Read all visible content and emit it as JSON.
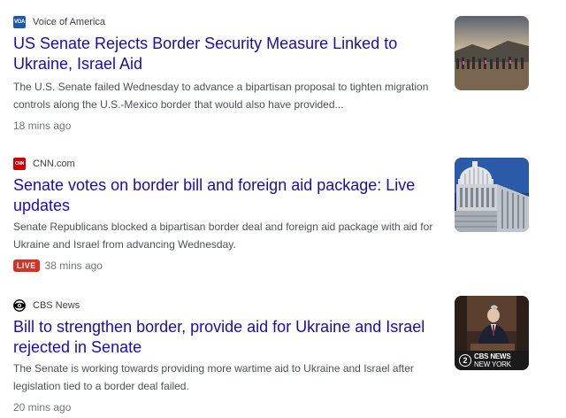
{
  "articles": [
    {
      "source": "Voice of America",
      "favicon_text": "VOA",
      "headline": "US Senate Rejects Border Security Measure Linked to Ukraine, Israel Aid",
      "snippet": "The U.S. Senate failed Wednesday to advance a bipartisan proposal to tighten migration controls along the U.S.-Mexico border that would also have provided...",
      "time": "18 mins ago",
      "live": false
    },
    {
      "source": "CNN.com",
      "favicon_text": "CNN",
      "headline": "Senate votes on border bill and foreign aid package: Live updates",
      "snippet": "Senate Republicans blocked a bipartisan border deal and foreign aid package with aid for Ukraine and Israel from advancing Wednesday.",
      "time": "38 mins ago",
      "live": true,
      "live_label": "LIVE"
    },
    {
      "source": "CBS News",
      "headline": "Bill to strengthen border, provide aid for Ukraine and Israel rejected in Senate",
      "snippet": "The Senate is working towards providing more wartime aid to Ukraine and Israel after legislation tied to a border deal failed.",
      "time": "20 mins ago",
      "live": false,
      "thumb_overlay": {
        "channel": "2",
        "brand": "CBS NEWS",
        "city": "NEW YORK"
      }
    }
  ],
  "colors": {
    "headline": "#1a0dab",
    "snippet": "#4d5156",
    "time": "#70757a",
    "live": "#d93025"
  },
  "icons": [
    "voa-favicon",
    "cnn-favicon",
    "cbs-eye-icon"
  ]
}
